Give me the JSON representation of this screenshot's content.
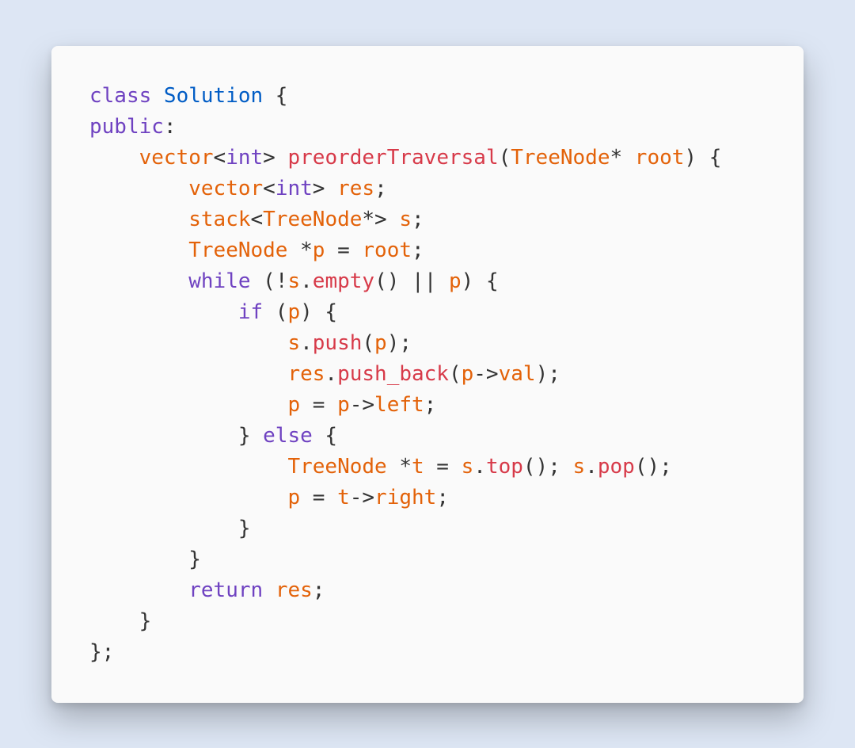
{
  "code": {
    "tokens": [
      [
        {
          "t": "class ",
          "c": "kw"
        },
        {
          "t": "Solution",
          "c": "cls"
        },
        {
          "t": " {",
          "c": "punc"
        }
      ],
      [
        {
          "t": "public",
          "c": "kw"
        },
        {
          "t": ":",
          "c": "punc"
        }
      ],
      [
        {
          "t": "    ",
          "c": "punc"
        },
        {
          "t": "vector",
          "c": "type"
        },
        {
          "t": "<",
          "c": "lt"
        },
        {
          "t": "int",
          "c": "kw"
        },
        {
          "t": "> ",
          "c": "lt"
        },
        {
          "t": "preorderTraversal",
          "c": "fn"
        },
        {
          "t": "(",
          "c": "punc"
        },
        {
          "t": "TreeNode",
          "c": "type"
        },
        {
          "t": "* ",
          "c": "lt"
        },
        {
          "t": "root",
          "c": "type"
        },
        {
          "t": ") {",
          "c": "punc"
        }
      ],
      [
        {
          "t": "        ",
          "c": "punc"
        },
        {
          "t": "vector",
          "c": "type"
        },
        {
          "t": "<",
          "c": "lt"
        },
        {
          "t": "int",
          "c": "kw"
        },
        {
          "t": "> ",
          "c": "lt"
        },
        {
          "t": "res",
          "c": "type"
        },
        {
          "t": ";",
          "c": "punc"
        }
      ],
      [
        {
          "t": "        ",
          "c": "punc"
        },
        {
          "t": "stack",
          "c": "type"
        },
        {
          "t": "<",
          "c": "lt"
        },
        {
          "t": "TreeNode",
          "c": "type"
        },
        {
          "t": "*> ",
          "c": "lt"
        },
        {
          "t": "s",
          "c": "type"
        },
        {
          "t": ";",
          "c": "punc"
        }
      ],
      [
        {
          "t": "        ",
          "c": "punc"
        },
        {
          "t": "TreeNode",
          "c": "type"
        },
        {
          "t": " *",
          "c": "lt"
        },
        {
          "t": "p",
          "c": "type"
        },
        {
          "t": " = ",
          "c": "lt"
        },
        {
          "t": "root",
          "c": "type"
        },
        {
          "t": ";",
          "c": "punc"
        }
      ],
      [
        {
          "t": "        ",
          "c": "punc"
        },
        {
          "t": "while",
          "c": "kw"
        },
        {
          "t": " (!",
          "c": "lt"
        },
        {
          "t": "s",
          "c": "type"
        },
        {
          "t": ".",
          "c": "lt"
        },
        {
          "t": "empty",
          "c": "fn"
        },
        {
          "t": "() || ",
          "c": "lt"
        },
        {
          "t": "p",
          "c": "type"
        },
        {
          "t": ") {",
          "c": "punc"
        }
      ],
      [
        {
          "t": "            ",
          "c": "punc"
        },
        {
          "t": "if",
          "c": "kw"
        },
        {
          "t": " (",
          "c": "lt"
        },
        {
          "t": "p",
          "c": "type"
        },
        {
          "t": ") {",
          "c": "punc"
        }
      ],
      [
        {
          "t": "                ",
          "c": "punc"
        },
        {
          "t": "s",
          "c": "type"
        },
        {
          "t": ".",
          "c": "lt"
        },
        {
          "t": "push",
          "c": "fn"
        },
        {
          "t": "(",
          "c": "lt"
        },
        {
          "t": "p",
          "c": "type"
        },
        {
          "t": ");",
          "c": "punc"
        }
      ],
      [
        {
          "t": "                ",
          "c": "punc"
        },
        {
          "t": "res",
          "c": "type"
        },
        {
          "t": ".",
          "c": "lt"
        },
        {
          "t": "push_back",
          "c": "fn"
        },
        {
          "t": "(",
          "c": "lt"
        },
        {
          "t": "p",
          "c": "type"
        },
        {
          "t": "->",
          "c": "lt"
        },
        {
          "t": "val",
          "c": "type"
        },
        {
          "t": ");",
          "c": "punc"
        }
      ],
      [
        {
          "t": "                ",
          "c": "punc"
        },
        {
          "t": "p",
          "c": "type"
        },
        {
          "t": " = ",
          "c": "lt"
        },
        {
          "t": "p",
          "c": "type"
        },
        {
          "t": "->",
          "c": "lt"
        },
        {
          "t": "left",
          "c": "type"
        },
        {
          "t": ";",
          "c": "punc"
        }
      ],
      [
        {
          "t": "            } ",
          "c": "punc"
        },
        {
          "t": "else",
          "c": "kw"
        },
        {
          "t": " {",
          "c": "punc"
        }
      ],
      [
        {
          "t": "                ",
          "c": "punc"
        },
        {
          "t": "TreeNode",
          "c": "type"
        },
        {
          "t": " *",
          "c": "lt"
        },
        {
          "t": "t",
          "c": "type"
        },
        {
          "t": " = ",
          "c": "lt"
        },
        {
          "t": "s",
          "c": "type"
        },
        {
          "t": ".",
          "c": "lt"
        },
        {
          "t": "top",
          "c": "fn"
        },
        {
          "t": "(); ",
          "c": "lt"
        },
        {
          "t": "s",
          "c": "type"
        },
        {
          "t": ".",
          "c": "lt"
        },
        {
          "t": "pop",
          "c": "fn"
        },
        {
          "t": "();",
          "c": "punc"
        }
      ],
      [
        {
          "t": "                ",
          "c": "punc"
        },
        {
          "t": "p",
          "c": "type"
        },
        {
          "t": " = ",
          "c": "lt"
        },
        {
          "t": "t",
          "c": "type"
        },
        {
          "t": "->",
          "c": "lt"
        },
        {
          "t": "right",
          "c": "type"
        },
        {
          "t": ";",
          "c": "punc"
        }
      ],
      [
        {
          "t": "            }",
          "c": "punc"
        }
      ],
      [
        {
          "t": "        }",
          "c": "punc"
        }
      ],
      [
        {
          "t": "        ",
          "c": "punc"
        },
        {
          "t": "return",
          "c": "kw"
        },
        {
          "t": " ",
          "c": "punc"
        },
        {
          "t": "res",
          "c": "type"
        },
        {
          "t": ";",
          "c": "punc"
        }
      ],
      [
        {
          "t": "    }",
          "c": "punc"
        }
      ],
      [
        {
          "t": "};",
          "c": "punc"
        }
      ]
    ]
  }
}
